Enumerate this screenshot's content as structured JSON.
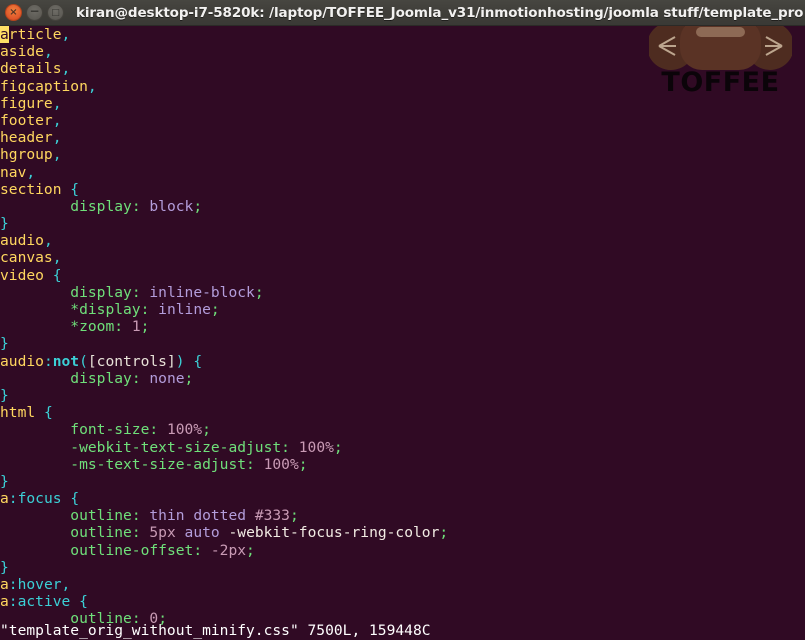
{
  "window": {
    "title": "kiran@desktop-i7-5820k: /laptop/TOFFEE_Joomla_v31/inmotionhosting/joomla stuff/template_pro",
    "controls": {
      "close_label": "×",
      "minimize_label": "−",
      "maximize_label": "□"
    }
  },
  "watermark": {
    "label": "TOFFEE",
    "colors": {
      "candy_body": "#5a3325",
      "candy_highlight": "#8d6a55",
      "wrapper": "#4e2c20",
      "text": "#0b0409"
    }
  },
  "terminal": {
    "background": "#300a24",
    "foreground": "#e8e2d8",
    "cursor_color": "#ffe066",
    "cursor_char": "a",
    "editor": "vim",
    "filename": "template_orig_without_minify.css",
    "status_line": "\"template_orig_without_minify.css\" 7500L, 159448C",
    "status_lines": "7500L",
    "status_chars": "159448C",
    "lines": [
      {
        "segments": [
          {
            "t": "a",
            "c": "cursor"
          },
          {
            "t": "rticle",
            "c": "sel"
          },
          {
            "t": ",",
            "c": "punc"
          }
        ]
      },
      {
        "segments": [
          {
            "t": "aside",
            "c": "sel"
          },
          {
            "t": ",",
            "c": "punc"
          }
        ]
      },
      {
        "segments": [
          {
            "t": "details",
            "c": "sel"
          },
          {
            "t": ",",
            "c": "punc"
          }
        ]
      },
      {
        "segments": [
          {
            "t": "figcaption",
            "c": "sel"
          },
          {
            "t": ",",
            "c": "punc"
          }
        ]
      },
      {
        "segments": [
          {
            "t": "figure",
            "c": "sel"
          },
          {
            "t": ",",
            "c": "punc"
          }
        ]
      },
      {
        "segments": [
          {
            "t": "footer",
            "c": "sel"
          },
          {
            "t": ",",
            "c": "punc"
          }
        ]
      },
      {
        "segments": [
          {
            "t": "header",
            "c": "sel"
          },
          {
            "t": ",",
            "c": "punc"
          }
        ]
      },
      {
        "segments": [
          {
            "t": "hgroup",
            "c": "sel"
          },
          {
            "t": ",",
            "c": "punc"
          }
        ]
      },
      {
        "segments": [
          {
            "t": "nav",
            "c": "sel"
          },
          {
            "t": ",",
            "c": "punc"
          }
        ]
      },
      {
        "segments": [
          {
            "t": "section ",
            "c": "sel"
          },
          {
            "t": "{",
            "c": "punc"
          }
        ]
      },
      {
        "segments": [
          {
            "t": "        ",
            "c": "plain"
          },
          {
            "t": "display",
            "c": "prop"
          },
          {
            "t": ": ",
            "c": "prop"
          },
          {
            "t": "block",
            "c": "val"
          },
          {
            "t": ";",
            "c": "prop"
          }
        ]
      },
      {
        "segments": [
          {
            "t": "}",
            "c": "punc"
          }
        ]
      },
      {
        "segments": [
          {
            "t": "audio",
            "c": "sel"
          },
          {
            "t": ",",
            "c": "punc"
          }
        ]
      },
      {
        "segments": [
          {
            "t": "canvas",
            "c": "sel"
          },
          {
            "t": ",",
            "c": "punc"
          }
        ]
      },
      {
        "segments": [
          {
            "t": "video ",
            "c": "sel"
          },
          {
            "t": "{",
            "c": "punc"
          }
        ]
      },
      {
        "segments": [
          {
            "t": "        ",
            "c": "plain"
          },
          {
            "t": "display",
            "c": "prop"
          },
          {
            "t": ": ",
            "c": "prop"
          },
          {
            "t": "inline-block",
            "c": "val"
          },
          {
            "t": ";",
            "c": "prop"
          }
        ]
      },
      {
        "segments": [
          {
            "t": "        ",
            "c": "plain"
          },
          {
            "t": "*display",
            "c": "prop"
          },
          {
            "t": ": ",
            "c": "prop"
          },
          {
            "t": "inline",
            "c": "val"
          },
          {
            "t": ";",
            "c": "prop"
          }
        ]
      },
      {
        "segments": [
          {
            "t": "        ",
            "c": "plain"
          },
          {
            "t": "*zoom",
            "c": "prop"
          },
          {
            "t": ": ",
            "c": "prop"
          },
          {
            "t": "1",
            "c": "num"
          },
          {
            "t": ";",
            "c": "prop"
          }
        ]
      },
      {
        "segments": [
          {
            "t": "}",
            "c": "punc"
          }
        ]
      },
      {
        "segments": [
          {
            "t": "audio",
            "c": "sel"
          },
          {
            "t": ":",
            "c": "punc"
          },
          {
            "t": "not",
            "c": "pseudob"
          },
          {
            "t": "(",
            "c": "punc"
          },
          {
            "t": "[controls]",
            "c": "attrsel"
          },
          {
            "t": ") ",
            "c": "punc"
          },
          {
            "t": "{",
            "c": "punc"
          }
        ]
      },
      {
        "segments": [
          {
            "t": "        ",
            "c": "plain"
          },
          {
            "t": "display",
            "c": "prop"
          },
          {
            "t": ": ",
            "c": "prop"
          },
          {
            "t": "none",
            "c": "val"
          },
          {
            "t": ";",
            "c": "prop"
          }
        ]
      },
      {
        "segments": [
          {
            "t": "}",
            "c": "punc"
          }
        ]
      },
      {
        "segments": [
          {
            "t": "html ",
            "c": "sel"
          },
          {
            "t": "{",
            "c": "punc"
          }
        ]
      },
      {
        "segments": [
          {
            "t": "        ",
            "c": "plain"
          },
          {
            "t": "font-size",
            "c": "prop"
          },
          {
            "t": ": ",
            "c": "prop"
          },
          {
            "t": "100%",
            "c": "num"
          },
          {
            "t": ";",
            "c": "prop"
          }
        ]
      },
      {
        "segments": [
          {
            "t": "        ",
            "c": "plain"
          },
          {
            "t": "-webkit-text-size-adjust",
            "c": "prop"
          },
          {
            "t": ": ",
            "c": "prop"
          },
          {
            "t": "100%",
            "c": "num"
          },
          {
            "t": ";",
            "c": "prop"
          }
        ]
      },
      {
        "segments": [
          {
            "t": "        ",
            "c": "plain"
          },
          {
            "t": "-ms-text-size-adjust",
            "c": "prop"
          },
          {
            "t": ": ",
            "c": "prop"
          },
          {
            "t": "100%",
            "c": "num"
          },
          {
            "t": ";",
            "c": "prop"
          }
        ]
      },
      {
        "segments": [
          {
            "t": "}",
            "c": "punc"
          }
        ]
      },
      {
        "segments": [
          {
            "t": "a",
            "c": "sel"
          },
          {
            "t": ":focus",
            "c": "pseudo"
          },
          {
            "t": " ",
            "c": "plain"
          },
          {
            "t": "{",
            "c": "punc"
          }
        ]
      },
      {
        "segments": [
          {
            "t": "        ",
            "c": "plain"
          },
          {
            "t": "outline",
            "c": "prop"
          },
          {
            "t": ": ",
            "c": "prop"
          },
          {
            "t": "thin dotted ",
            "c": "val"
          },
          {
            "t": "#333",
            "c": "num"
          },
          {
            "t": ";",
            "c": "prop"
          }
        ]
      },
      {
        "segments": [
          {
            "t": "        ",
            "c": "plain"
          },
          {
            "t": "outline",
            "c": "prop"
          },
          {
            "t": ": ",
            "c": "prop"
          },
          {
            "t": "5px",
            "c": "num"
          },
          {
            "t": " ",
            "c": "plain"
          },
          {
            "t": "auto",
            "c": "val"
          },
          {
            "t": " ",
            "c": "plain"
          },
          {
            "t": "-webkit-focus-ring-color",
            "c": "plain"
          },
          {
            "t": ";",
            "c": "prop"
          }
        ]
      },
      {
        "segments": [
          {
            "t": "        ",
            "c": "plain"
          },
          {
            "t": "outline-offset",
            "c": "prop"
          },
          {
            "t": ": ",
            "c": "prop"
          },
          {
            "t": "-2px",
            "c": "num"
          },
          {
            "t": ";",
            "c": "prop"
          }
        ]
      },
      {
        "segments": [
          {
            "t": "}",
            "c": "punc"
          }
        ]
      },
      {
        "segments": [
          {
            "t": "a",
            "c": "sel"
          },
          {
            "t": ":hover",
            "c": "pseudo"
          },
          {
            "t": ",",
            "c": "punc"
          }
        ]
      },
      {
        "segments": [
          {
            "t": "a",
            "c": "sel"
          },
          {
            "t": ":active",
            "c": "pseudo"
          },
          {
            "t": " ",
            "c": "plain"
          },
          {
            "t": "{",
            "c": "punc"
          }
        ]
      },
      {
        "segments": [
          {
            "t": "        ",
            "c": "plain"
          },
          {
            "t": "outline",
            "c": "prop"
          },
          {
            "t": ": ",
            "c": "prop"
          },
          {
            "t": "0",
            "c": "num"
          },
          {
            "t": ";",
            "c": "prop"
          }
        ]
      }
    ]
  }
}
